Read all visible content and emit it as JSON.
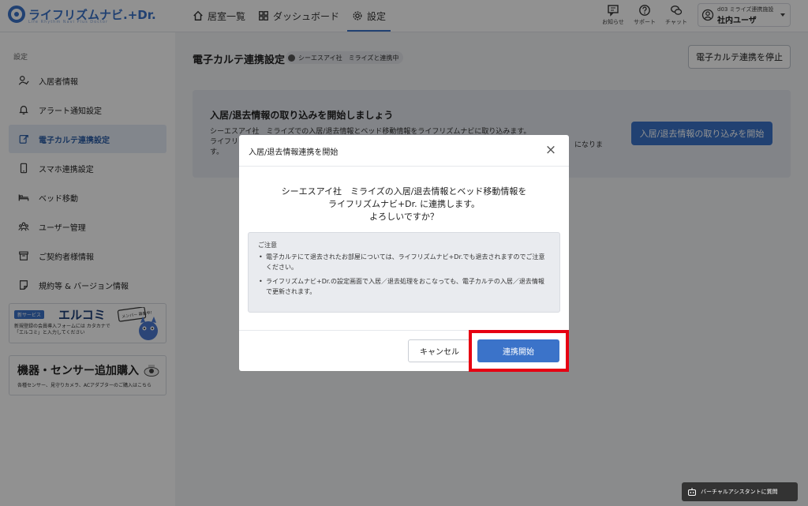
{
  "header": {
    "logo_text": "ライフリズムナビ.+Dr.",
    "logo_sub": "Life Rhythm Navi Plus Doctor",
    "nav": [
      {
        "label": "居室一覧",
        "icon": "home-icon"
      },
      {
        "label": "ダッシュボード",
        "icon": "dashboard-icon"
      },
      {
        "label": "設定",
        "icon": "gear-icon",
        "active": true
      }
    ],
    "notice_label": "お知らせ",
    "support_label": "サポート",
    "chat_label": "チャット",
    "user_org": "d03 ミライズ連携施設",
    "user_name": "社内ユーザ"
  },
  "sidebar": {
    "heading": "設定",
    "items": [
      {
        "label": "入居者情報",
        "icon": "resident-icon"
      },
      {
        "label": "アラート通知設定",
        "icon": "bell-icon"
      },
      {
        "label": "電子カルテ連携設定",
        "icon": "link-icon",
        "active": true
      },
      {
        "label": "スマホ連携設定",
        "icon": "phone-icon"
      },
      {
        "label": "ベッド移動",
        "icon": "bed-icon"
      },
      {
        "label": "ユーザー管理",
        "icon": "users-icon"
      },
      {
        "label": "ご契約者様情報",
        "icon": "contract-icon"
      },
      {
        "label": "規約等 & バージョン情報",
        "icon": "document-icon"
      }
    ],
    "promo1": {
      "tag": "新サービス",
      "title": "エルコミ",
      "desc": "新規登録の会員導入フォームには カタカナで「エルコミ」と入力してください",
      "badge": "メンバー 募集中!"
    },
    "promo2": {
      "title": "機器・センサー追加購入",
      "desc": "各種センサー、見守りカメラ、ACアダプターのご購入はこちら"
    }
  },
  "main": {
    "title": "電子カルテ連携設定",
    "status": "シーエスアイ社　ミライズと連携中",
    "stop_button": "電子カルテ連携を停止",
    "card": {
      "title": "入居/退去情報の取り込みを開始しましょう",
      "desc_line1": "シーエスアイ社　ミライズでの入居/退去情報とベッド移動情報をライフリズムナビに取り込みます。",
      "desc_line2": "ライフリ",
      "desc_line3": "す。",
      "desc_tail": "になりま",
      "button": "入居/退去情報の取り込みを開始"
    }
  },
  "modal": {
    "title": "入居/退去情報連携を開始",
    "close": "×",
    "message_line1": "シーエスアイ社　ミライズの入居/退去情報とベッド移動情報を",
    "message_line2": "ライフリズムナビ+Dr. に連携します。",
    "message_line3": "よろしいですか？",
    "notice_title": "ご注意",
    "notice_items": [
      "電子カルテにて退去されたお部屋については、ライフリズムナビ+Dr.でも退去されますのでご注意ください。",
      "ライフリズムナビ+Dr.の設定画面で入居／退去処理をおこなっても、電子カルテの入居／退去情報で更新されます。"
    ],
    "cancel": "キャンセル",
    "confirm": "連携開始"
  },
  "assistant_label": "バーチャルアシスタントに質問"
}
